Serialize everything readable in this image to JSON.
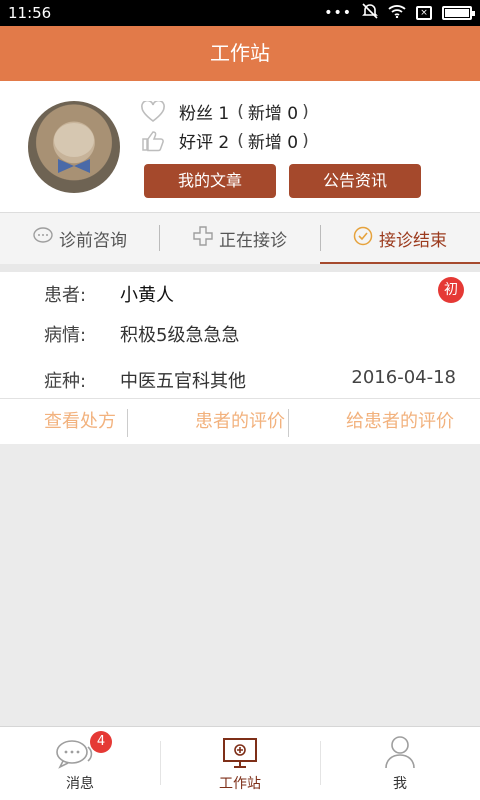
{
  "status_bar": {
    "time": "11:56",
    "icons": [
      "more-dots-icon",
      "alarm-off-icon",
      "wifi-icon",
      "sim-icon",
      "battery-icon"
    ]
  },
  "header": {
    "title": "工作站"
  },
  "profile": {
    "fans_label": "粉丝 1",
    "fans_new": "新增 0",
    "rating_label": "好评 2",
    "rating_new": "新增 0",
    "paren_open": "(",
    "paren_close": ")",
    "buttons": {
      "my_articles": "我的文章",
      "announcements": "公告资讯"
    }
  },
  "tabs": [
    {
      "label": "诊前咨询",
      "icon": "chat-bubble-icon",
      "active": false
    },
    {
      "label": "正在接诊",
      "icon": "medical-cross-icon",
      "active": false
    },
    {
      "label": "接诊结束",
      "icon": "check-circle-icon",
      "active": true
    }
  ],
  "record": {
    "patient_key": "患者:",
    "patient_value": "小黄人",
    "badge": "初",
    "condition_key": "病情:",
    "condition_value": "积极5级急急急",
    "type_key": "症种:",
    "type_value": "中医五官科其他",
    "date": "2016-04-18",
    "actions": [
      "查看处方",
      "患者的评价",
      "给患者的评价"
    ]
  },
  "bottom_nav": [
    {
      "label": "消息",
      "icon": "message-icon",
      "badge": "4",
      "active": false
    },
    {
      "label": "工作站",
      "icon": "monitor-icon",
      "active": true
    },
    {
      "label": "我",
      "icon": "person-icon",
      "active": false
    }
  ],
  "colors": {
    "header": "#e27a49",
    "button": "#a5492c",
    "action_text": "#f2b27e",
    "badge": "#e53935"
  }
}
